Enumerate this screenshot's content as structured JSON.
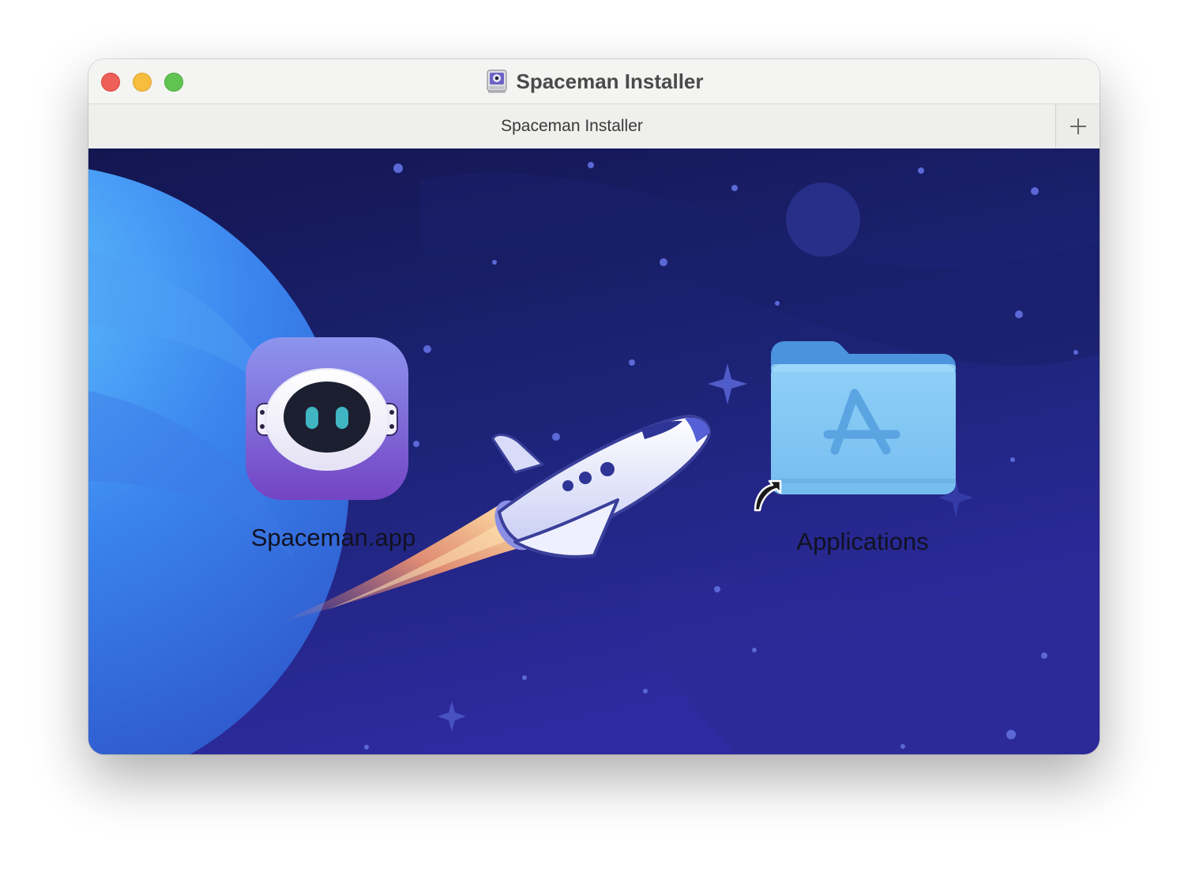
{
  "window": {
    "title": "Spaceman Installer",
    "title_icon": "disk-image-icon"
  },
  "tabs": [
    {
      "label": "Spaceman Installer"
    }
  ],
  "tab_add_label": "+",
  "items": {
    "app": {
      "label": "Spaceman.app",
      "icon": "spaceman-app-icon"
    },
    "applications": {
      "label": "Applications",
      "icon": "applications-folder-icon",
      "badge": "alias-arrow-icon"
    }
  },
  "colors": {
    "background_top": "#141752",
    "background_bottom": "#2d2a9c",
    "planet": "#3f8df0",
    "app_icon_top": "#8d95ee",
    "app_icon_bottom": "#7645c6",
    "folder": "#7fc2f2"
  }
}
